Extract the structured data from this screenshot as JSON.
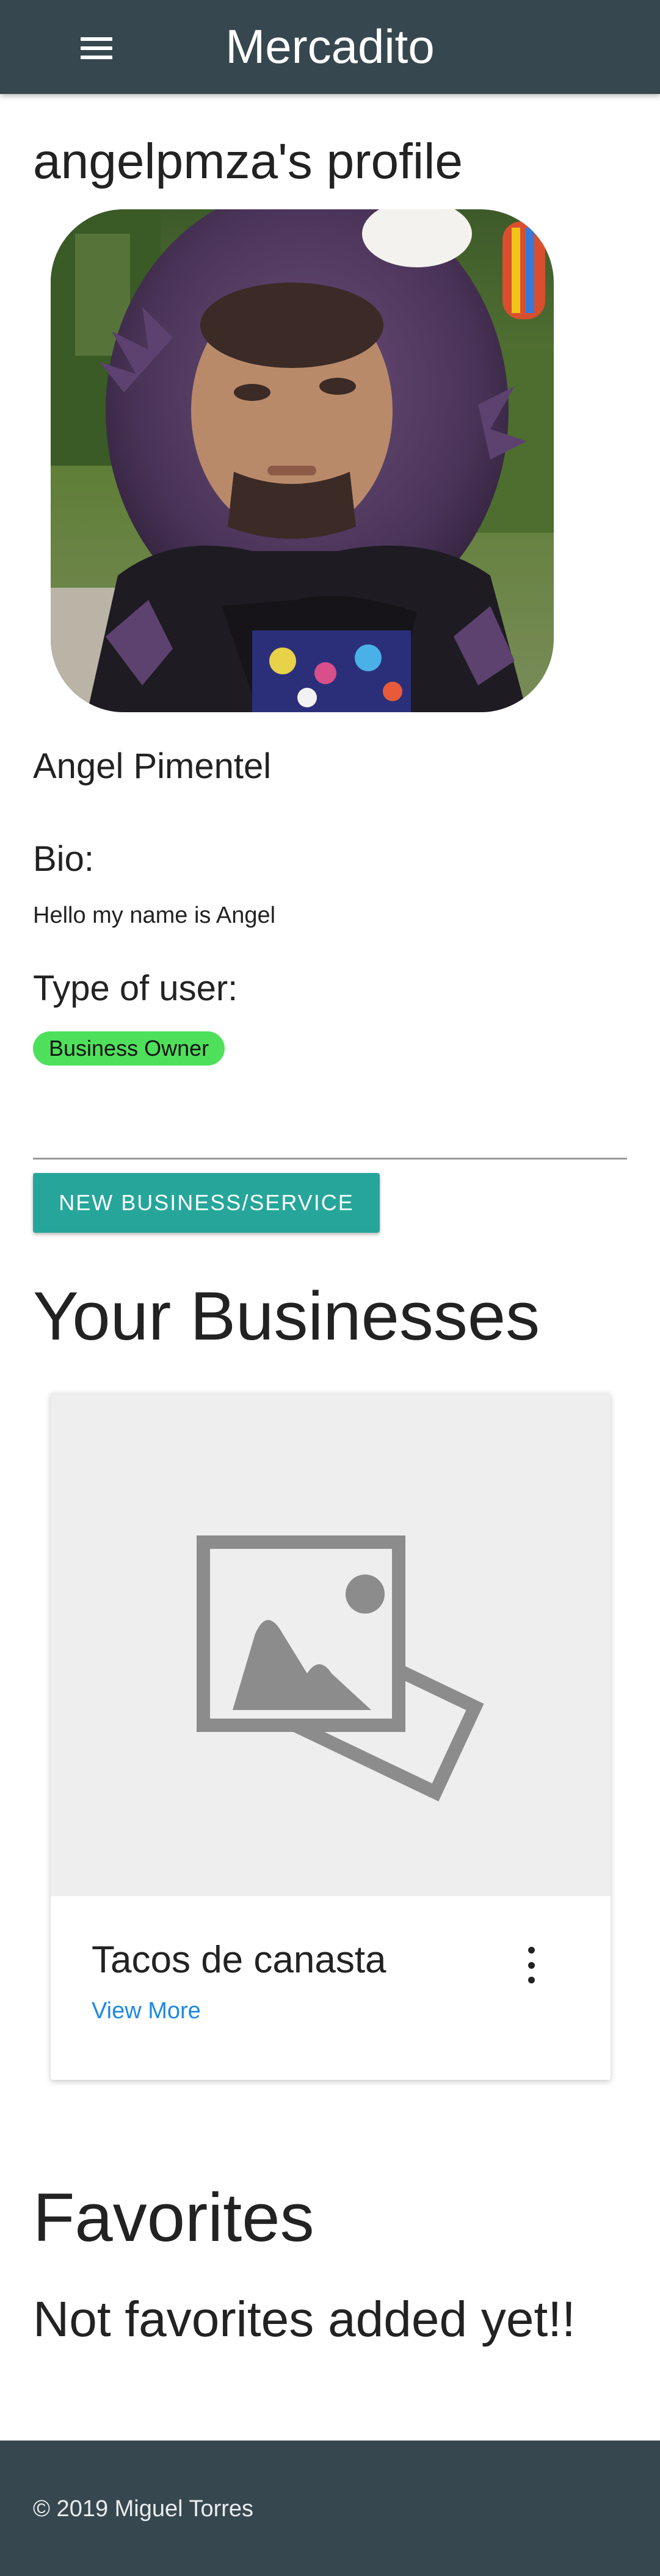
{
  "header": {
    "app_title": "Mercadito",
    "menu_icon": "hamburger-menu-icon"
  },
  "profile": {
    "heading": "angelpmza's profile",
    "full_name": "Angel Pimentel",
    "bio_label": "Bio:",
    "bio_text": "Hello my name is Angel",
    "type_label": "Type of user:",
    "user_type_badge": "Business Owner",
    "badge_color": "#4ee05b"
  },
  "actions": {
    "new_business_label": "NEW BUSINESS/SERVICE",
    "accent_color": "#26a69a"
  },
  "businesses": {
    "heading": "Your Businesses",
    "items": [
      {
        "title": "Tacos de canasta",
        "link_label": "View More",
        "image_icon": "image-placeholder-icon",
        "menu_icon": "more-vert-icon"
      }
    ]
  },
  "favorites": {
    "heading": "Favorites",
    "empty_message": "Not favorites added yet!!"
  },
  "footer": {
    "copyright": "© 2019 Miguel Torres",
    "bar_color": "#37474f"
  }
}
